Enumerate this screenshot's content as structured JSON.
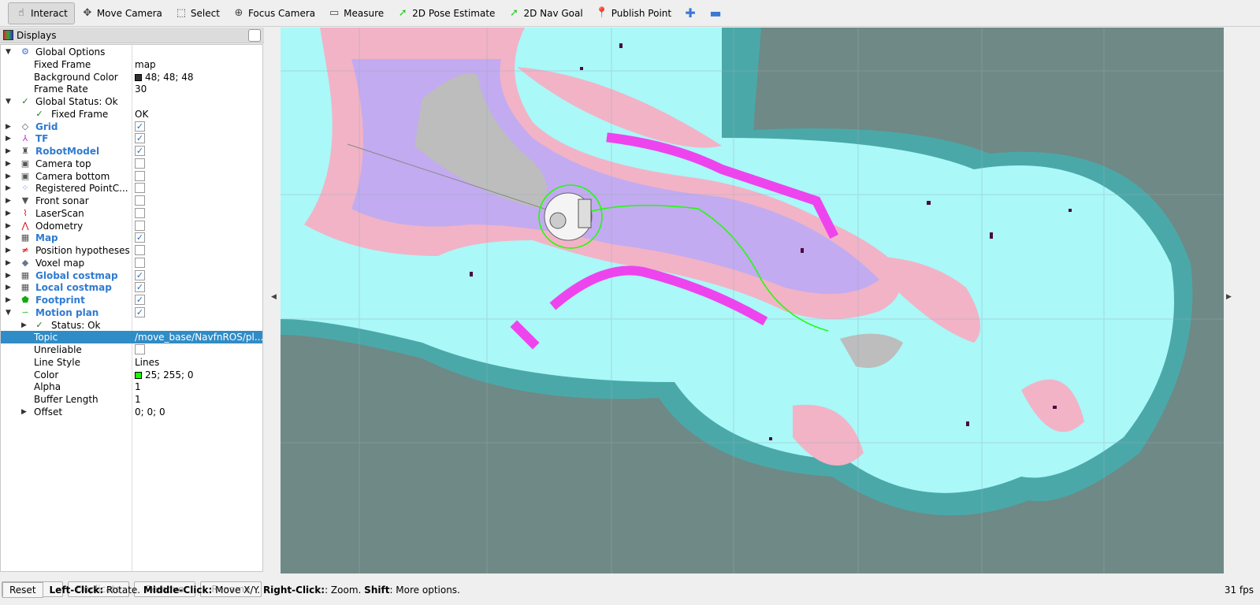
{
  "toolbar": {
    "tools": [
      {
        "label": "Interact",
        "icon": "hand-icon",
        "active": true
      },
      {
        "label": "Move Camera",
        "icon": "move-camera-icon"
      },
      {
        "label": "Select",
        "icon": "select-box-icon"
      },
      {
        "label": "Focus Camera",
        "icon": "focus-camera-icon"
      },
      {
        "label": "Measure",
        "icon": "ruler-icon"
      },
      {
        "label": "2D Pose Estimate",
        "icon": "green-arrow-icon"
      },
      {
        "label": "2D Nav Goal",
        "icon": "green-arrow-icon"
      },
      {
        "label": "Publish Point",
        "icon": "map-pin-icon"
      }
    ]
  },
  "displays": {
    "title": "Displays",
    "rows": [
      {
        "label": "Global Options",
        "indent": 0,
        "expand": "open",
        "icon": "gear-icon"
      },
      {
        "label": "Fixed Frame",
        "indent": 1,
        "value": "map"
      },
      {
        "label": "Background Color",
        "indent": 1,
        "value": "48; 48; 48",
        "swatch": "#303030"
      },
      {
        "label": "Frame Rate",
        "indent": 1,
        "value": "30"
      },
      {
        "label": "Global Status: Ok",
        "indent": 0,
        "expand": "open",
        "icon": "check-icon"
      },
      {
        "label": "Fixed Frame",
        "indent": 1,
        "value": "OK",
        "icon": "check-icon",
        "sub": true
      },
      {
        "label": "Grid",
        "bold": true,
        "expand": "closed",
        "icon": "grid-icon",
        "checked": true
      },
      {
        "label": "TF",
        "bold": true,
        "expand": "closed",
        "icon": "tf-axes-icon",
        "checked": true
      },
      {
        "label": "RobotModel",
        "bold": true,
        "expand": "closed",
        "icon": "robot-icon",
        "checked": true
      },
      {
        "label": "Camera top",
        "expand": "closed",
        "icon": "camera-icon",
        "checked": false
      },
      {
        "label": "Camera bottom",
        "expand": "closed",
        "icon": "camera-icon",
        "checked": false
      },
      {
        "label": "Registered PointC...",
        "expand": "closed",
        "icon": "pointcloud-icon",
        "checked": false
      },
      {
        "label": "Front sonar",
        "expand": "closed",
        "icon": "sonar-cone-icon",
        "checked": false
      },
      {
        "label": "LaserScan",
        "expand": "closed",
        "icon": "laserscan-icon",
        "checked": false
      },
      {
        "label": "Odometry",
        "expand": "closed",
        "icon": "odometry-icon",
        "checked": false
      },
      {
        "label": "Map",
        "bold": true,
        "expand": "closed",
        "icon": "map-grid-icon",
        "checked": true
      },
      {
        "label": "Position hypotheses",
        "expand": "closed",
        "icon": "pose-array-icon",
        "checked": false
      },
      {
        "label": "Voxel map",
        "expand": "closed",
        "icon": "voxel-icon",
        "checked": false
      },
      {
        "label": "Global costmap",
        "bold": true,
        "expand": "closed",
        "icon": "map-grid-icon",
        "checked": true
      },
      {
        "label": "Local costmap",
        "bold": true,
        "expand": "closed",
        "icon": "map-grid-icon",
        "checked": true
      },
      {
        "label": "Footprint",
        "bold": true,
        "expand": "closed",
        "icon": "polygon-icon",
        "checked": true
      },
      {
        "label": "Motion plan",
        "bold": true,
        "expand": "open",
        "icon": "path-icon",
        "checked": true
      },
      {
        "label": "Status: Ok",
        "indent": 1,
        "expand": "closed",
        "icon": "check-icon",
        "sub": true
      },
      {
        "label": "Topic",
        "indent": 1,
        "value": "/move_base/NavfnROS/pl...",
        "selected": true
      },
      {
        "label": "Unreliable",
        "indent": 1,
        "checked": false
      },
      {
        "label": "Line Style",
        "indent": 1,
        "value": "Lines"
      },
      {
        "label": "Color",
        "indent": 1,
        "value": "25; 255; 0",
        "swatch": "#19ff00"
      },
      {
        "label": "Alpha",
        "indent": 1,
        "value": "1"
      },
      {
        "label": "Buffer Length",
        "indent": 1,
        "value": "1"
      },
      {
        "label": "Offset",
        "indent": 1,
        "value": "0; 0; 0",
        "expand": "closed"
      }
    ],
    "buttons": [
      {
        "label": "Add",
        "enabled": true
      },
      {
        "label": "Duplicate",
        "enabled": false
      },
      {
        "label": "Remove",
        "enabled": false
      },
      {
        "label": "Rename",
        "enabled": false
      }
    ]
  },
  "status": {
    "reset": "Reset",
    "b1": "Left-Click:",
    "t1": " Rotate. ",
    "b2": "Middle-Click:",
    "t2": " Move X/Y. ",
    "b3": "Right-Click:",
    "t3": ": Zoom. ",
    "b4": "Shift",
    "t4": ": More options.",
    "fps": "31 fps"
  },
  "colors": {
    "background": "#6f8986",
    "inflation_outer": "#4aa9a8",
    "free": "#aaf8f8",
    "inflation_pink": "#f2b3c6",
    "inflation_lavender": "#c2abf0",
    "lethal": "#ee44ee",
    "obstacle": "#4a0a3a",
    "path": "#19ff00"
  }
}
